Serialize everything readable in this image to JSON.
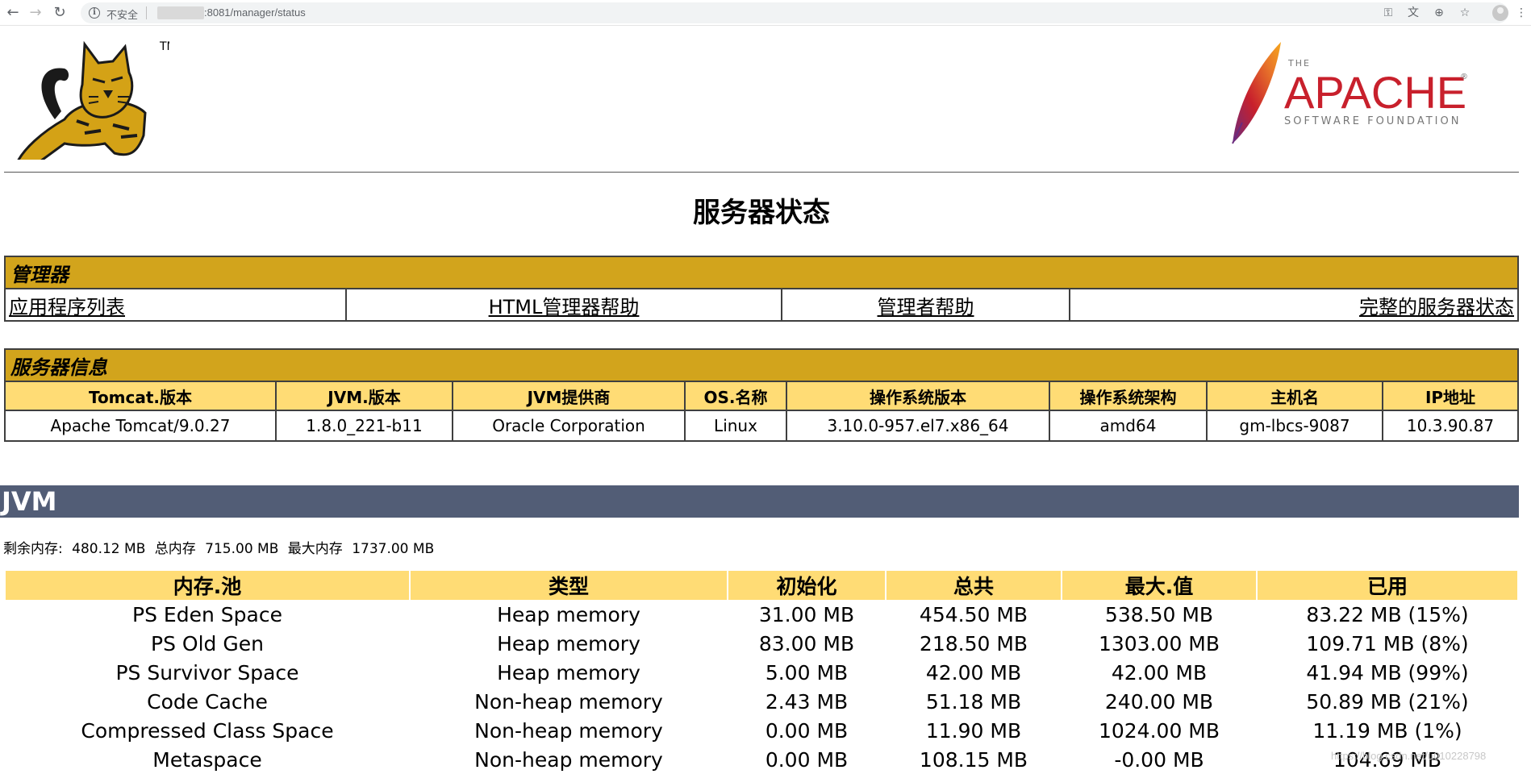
{
  "browser": {
    "insecure_label": "不安全",
    "url_path": ":8081/manager/status"
  },
  "title": "服务器状态",
  "manager": {
    "heading": "管理器",
    "links": [
      "应用程序列表",
      "HTML管理器帮助",
      "管理者帮助",
      "完整的服务器状态"
    ]
  },
  "server_info": {
    "heading": "服务器信息",
    "columns": [
      "Tomcat.版本",
      "JVM.版本",
      "JVM提供商",
      "OS.名称",
      "操作系统版本",
      "操作系统架构",
      "主机名",
      "IP地址"
    ],
    "values": [
      "Apache Tomcat/9.0.27",
      "1.8.0_221-b11",
      "Oracle Corporation",
      "Linux",
      "3.10.0-957.el7.x86_64",
      "amd64",
      "gm-lbcs-9087",
      "10.3.90.87"
    ]
  },
  "jvm": {
    "heading": "JVM",
    "memory": {
      "free_label": "剩余内存:",
      "free_value": "480.12 MB",
      "total_label": "总内存",
      "total_value": "715.00 MB",
      "max_label": "最大内存",
      "max_value": "1737.00 MB"
    },
    "pool_columns": [
      "内存.池",
      "类型",
      "初始化",
      "总共",
      "最大.值",
      "已用"
    ],
    "pools": [
      [
        "PS Eden Space",
        "Heap memory",
        "31.00 MB",
        "454.50 MB",
        "538.50 MB",
        "83.22 MB (15%)"
      ],
      [
        "PS Old Gen",
        "Heap memory",
        "83.00 MB",
        "218.50 MB",
        "1303.00 MB",
        "109.71 MB (8%)"
      ],
      [
        "PS Survivor Space",
        "Heap memory",
        "5.00 MB",
        "42.00 MB",
        "42.00 MB",
        "41.94 MB (99%)"
      ],
      [
        "Code Cache",
        "Non-heap memory",
        "2.43 MB",
        "51.18 MB",
        "240.00 MB",
        "50.89 MB (21%)"
      ],
      [
        "Compressed Class Space",
        "Non-heap memory",
        "0.00 MB",
        "11.90 MB",
        "1024.00 MB",
        "11.19 MB (1%)"
      ],
      [
        "Metaspace",
        "Non-heap memory",
        "0.00 MB",
        "108.15 MB",
        "-0.00 MB",
        "104.69 MB"
      ]
    ]
  },
  "logos": {
    "tomcat_tm": "TM",
    "apache_the": "THE",
    "apache_name": "APACHE",
    "apache_reg": "®",
    "apache_sub": "SOFTWARE FOUNDATION"
  },
  "watermark": "https://blog.csdn.net/u010228798",
  "colors": {
    "section_gold": "#d2a41c",
    "header_yellow": "#ffdc75",
    "jvm_banner": "#525d76",
    "apache_red": "#c8202c"
  }
}
